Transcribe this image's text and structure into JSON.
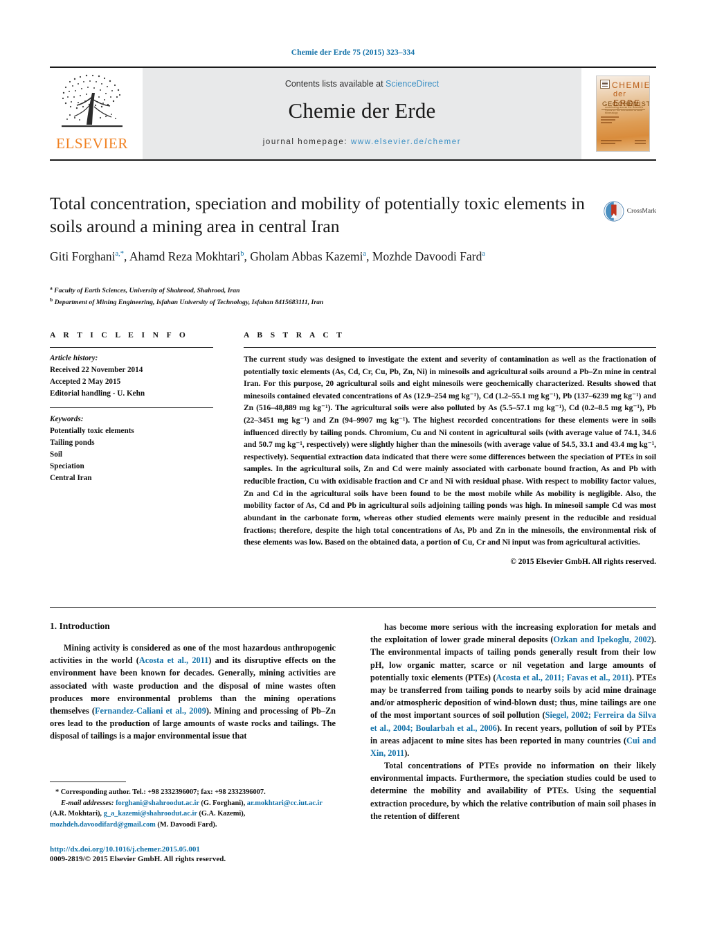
{
  "runhead": "Chemie der Erde 75 (2015) 323–334",
  "masthead": {
    "publisher": "ELSEVIER",
    "contents_prefix": "Contents lists available at ",
    "contents_link": "ScienceDirect",
    "journal_name": "Chemie der Erde",
    "homepage_prefix": "journal homepage: ",
    "homepage_link": "www.elsevier.de/chemer",
    "cover": {
      "line1": "CHEMIE",
      "line2_small": "der",
      "line2_big": "ERDE",
      "line3": "GEOCHEMISTRY",
      "subline": "contributing across the Scientific Focus on the Interaction around Mineralogy"
    }
  },
  "article": {
    "title": "Total concentration, speciation and mobility of potentially toxic elements in soils around a mining area in central Iran",
    "authors": [
      {
        "name": "Giti Forghani",
        "marks": "a,*"
      },
      {
        "name": "Ahamd Reza Mokhtari",
        "marks": "b"
      },
      {
        "name": "Gholam Abbas Kazemi",
        "marks": "a"
      },
      {
        "name": "Mozhde Davoodi Fard",
        "marks": "a"
      }
    ],
    "affiliations": [
      {
        "mark": "a",
        "text": "Faculty of Earth Sciences, University of Shahrood, Shahrood, Iran"
      },
      {
        "mark": "b",
        "text": "Department of Mining Engineering, Isfahan University of Technology, Isfahan 8415683111, Iran"
      }
    ],
    "crossmark_label": "CrossMark"
  },
  "info": {
    "heading": "A R T I C L E    I N F O",
    "history_label": "Article history:",
    "history": [
      "Received 22 November 2014",
      "Accepted 2 May 2015",
      "Editorial handling - U. Kehn"
    ],
    "keywords_label": "Keywords:",
    "keywords": [
      "Potentially toxic elements",
      "Tailing ponds",
      "Soil",
      "Speciation",
      "Central Iran"
    ]
  },
  "abstract": {
    "heading": "A B S T R A C T",
    "text": "The current study was designed to investigate the extent and severity of contamination as well as the fractionation of potentially toxic elements (As, Cd, Cr, Cu, Pb, Zn, Ni) in minesoils and agricultural soils around a Pb–Zn mine in central Iran. For this purpose, 20 agricultural soils and eight minesoils were geochemically characterized. Results showed that minesoils contained elevated concentrations of As (12.9–254 mg kg⁻¹), Cd (1.2–55.1 mg kg⁻¹), Pb (137–6239 mg kg⁻¹) and Zn (516–48,889 mg kg⁻¹). The agricultural soils were also polluted by As (5.5–57.1 mg kg⁻¹), Cd (0.2–8.5 mg kg⁻¹), Pb (22–3451 mg kg⁻¹) and Zn (94–9907 mg kg⁻¹). The highest recorded concentrations for these elements were in soils influenced directly by tailing ponds. Chromium, Cu and Ni content in agricultural soils (with average value of 74.1, 34.6 and 50.7 mg kg⁻¹, respectively) were slightly higher than the minesoils (with average value of 54.5, 33.1 and 43.4 mg kg⁻¹, respectively). Sequential extraction data indicated that there were some differences between the speciation of PTEs in soil samples. In the agricultural soils, Zn and Cd were mainly associated with carbonate bound fraction, As and Pb with reducible fraction, Cu with oxidisable fraction and Cr and Ni with residual phase. With respect to mobility factor values, Zn and Cd in the agricultural soils have been found to be the most mobile while As mobility is negligible. Also, the mobility factor of As, Cd and Pb in agricultural soils adjoining tailing ponds was high. In minesoil sample Cd was most abundant in the carbonate form, whereas other studied elements were mainly present in the reducible and residual fractions; therefore, despite the high total concentrations of As, Pb and Zn in the minesoils, the environmental risk of these elements was low. Based on the obtained data, a portion of Cu, Cr and Ni input was from agricultural activities.",
    "copyright": "© 2015 Elsevier GmbH. All rights reserved."
  },
  "introduction": {
    "heading": "1.  Introduction",
    "left": [
      {
        "segments": [
          {
            "t": "Mining activity is considered as one of the most hazardous anthropogenic activities in the world (",
            "k": "n"
          },
          {
            "t": "Acosta et al., 2011",
            "k": "r"
          },
          {
            "t": ") and its disruptive effects on the environment have been known for decades. Generally, mining activities are associated with waste production and the disposal of mine wastes often produces more environmental problems than the mining operations themselves (",
            "k": "n"
          },
          {
            "t": "Fernandez-Caliani et al., 2009",
            "k": "r"
          },
          {
            "t": "). Mining and processing of Pb–Zn ores lead to the production of large amounts of waste rocks and tailings. The disposal of tailings is a major environmental issue that",
            "k": "n"
          }
        ]
      }
    ],
    "right": [
      {
        "segments": [
          {
            "t": "has become more serious with the increasing exploration for metals and the exploitation of lower grade mineral deposits (",
            "k": "n"
          },
          {
            "t": "Ozkan and Ipekoglu, 2002",
            "k": "r"
          },
          {
            "t": "). The environmental impacts of tailing ponds generally result from their low pH, low organic matter, scarce or nil vegetation and large amounts of potentially toxic elements (PTEs) (",
            "k": "n"
          },
          {
            "t": "Acosta et al., 2011; Favas et al., 2011",
            "k": "r"
          },
          {
            "t": "). PTEs may be transferred from tailing ponds to nearby soils by acid mine drainage and/or atmospheric deposition of wind-blown dust; thus, mine tailings are one of the most important sources of soil pollution (",
            "k": "n"
          },
          {
            "t": "Siegel, 2002; Ferreira da Silva et al., 2004; Boularbah et al., 2006",
            "k": "r"
          },
          {
            "t": "). In recent years, pollution of soil by PTEs in areas adjacent to mine sites has been reported in many countries (",
            "k": "n"
          },
          {
            "t": "Cui and Xin, 2011",
            "k": "r"
          },
          {
            "t": ").",
            "k": "n"
          }
        ]
      },
      {
        "segments": [
          {
            "t": "Total concentrations of PTEs provide no information on their likely environmental impacts. Furthermore, the speciation studies could be used to determine the mobility and availability of PTEs. Using the sequential extraction procedure, by which the relative contribution of main soil phases in the retention of different",
            "k": "n"
          }
        ]
      }
    ]
  },
  "footnotes": {
    "corresponding": "*  Corresponding author. Tel.: +98 2332396007; fax: +98 2332396007.",
    "email_label": "E-mail addresses:",
    "emails": [
      {
        "addr": "forghani@shahroodut.ac.ir",
        "who": "(G. Forghani),"
      },
      {
        "addr": "ar.mokhtari@cc.iut.ac.ir",
        "who": "(A.R. Mokhtari),"
      },
      {
        "addr": "g_a_kazemi@shahroodut.ac.ir",
        "who": "(G.A. Kazemi),"
      },
      {
        "addr": "mozhdeh.davoodifard@gmail.com",
        "who": "(M. Davoodi Fard)."
      }
    ],
    "doi": "http://dx.doi.org/10.1016/j.chemer.2015.05.001",
    "issn": "0009-2819/© 2015 Elsevier GmbH. All rights reserved."
  },
  "colors": {
    "link": "#1271a8",
    "elsevier_orange": "#f08020",
    "band_gray": "#e8e9ea"
  }
}
